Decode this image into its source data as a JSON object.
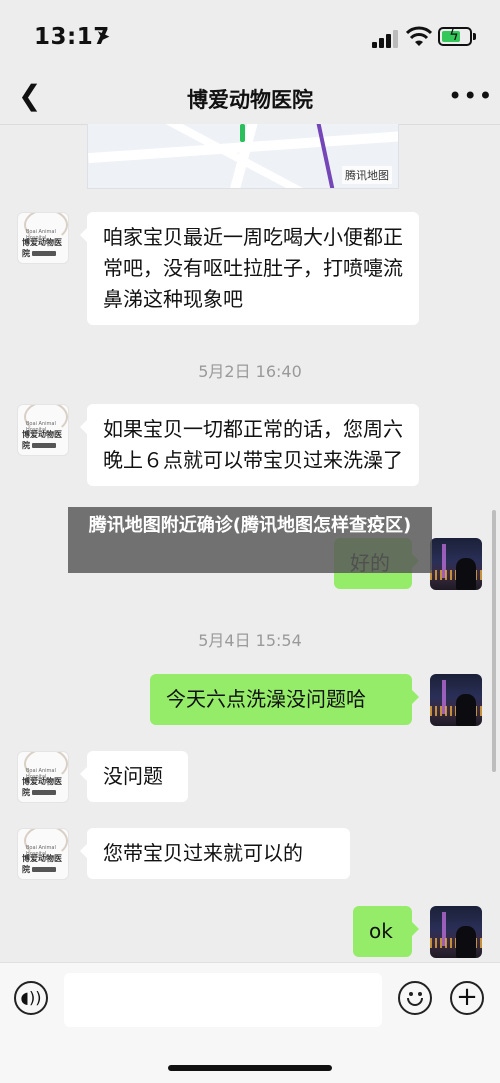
{
  "status_bar": {
    "time": "13:17",
    "location_icon": "location-arrow-icon"
  },
  "nav": {
    "back_icon": "chevron-left-icon",
    "title": "博爱动物医院",
    "more_icon": "more-dots-icon"
  },
  "map": {
    "badge": "腾讯地图"
  },
  "hospital_avatar": {
    "small_text": "Boai Animal Hospital",
    "name": "博爱动物医院"
  },
  "messages": {
    "m1": "咱家宝贝最近一周吃喝大小便都正常吧，没有呕吐拉肚子，打喷嚏流鼻涕这种现象吧",
    "ts1": "5月2日 16:40",
    "m2": "如果宝贝一切都正常的话，您周六晚上６点就可以带宝贝过来洗澡了",
    "m3": "好的",
    "ts2": "5月4日 15:54",
    "m4": "今天六点洗澡没问题哈",
    "m5": "没问题",
    "m6": "您带宝贝过来就可以的",
    "m7": "ok"
  },
  "overlay": {
    "text": "腾讯地图附近确诊(腾讯地图怎样查疫区)"
  },
  "input_bar": {
    "voice_icon": "voice-icon",
    "emoji_icon": "emoji-icon",
    "plus_icon": "plus-icon"
  },
  "colors": {
    "background": "#ededed",
    "outgoing_bubble": "#95ec69",
    "incoming_bubble": "#ffffff"
  }
}
